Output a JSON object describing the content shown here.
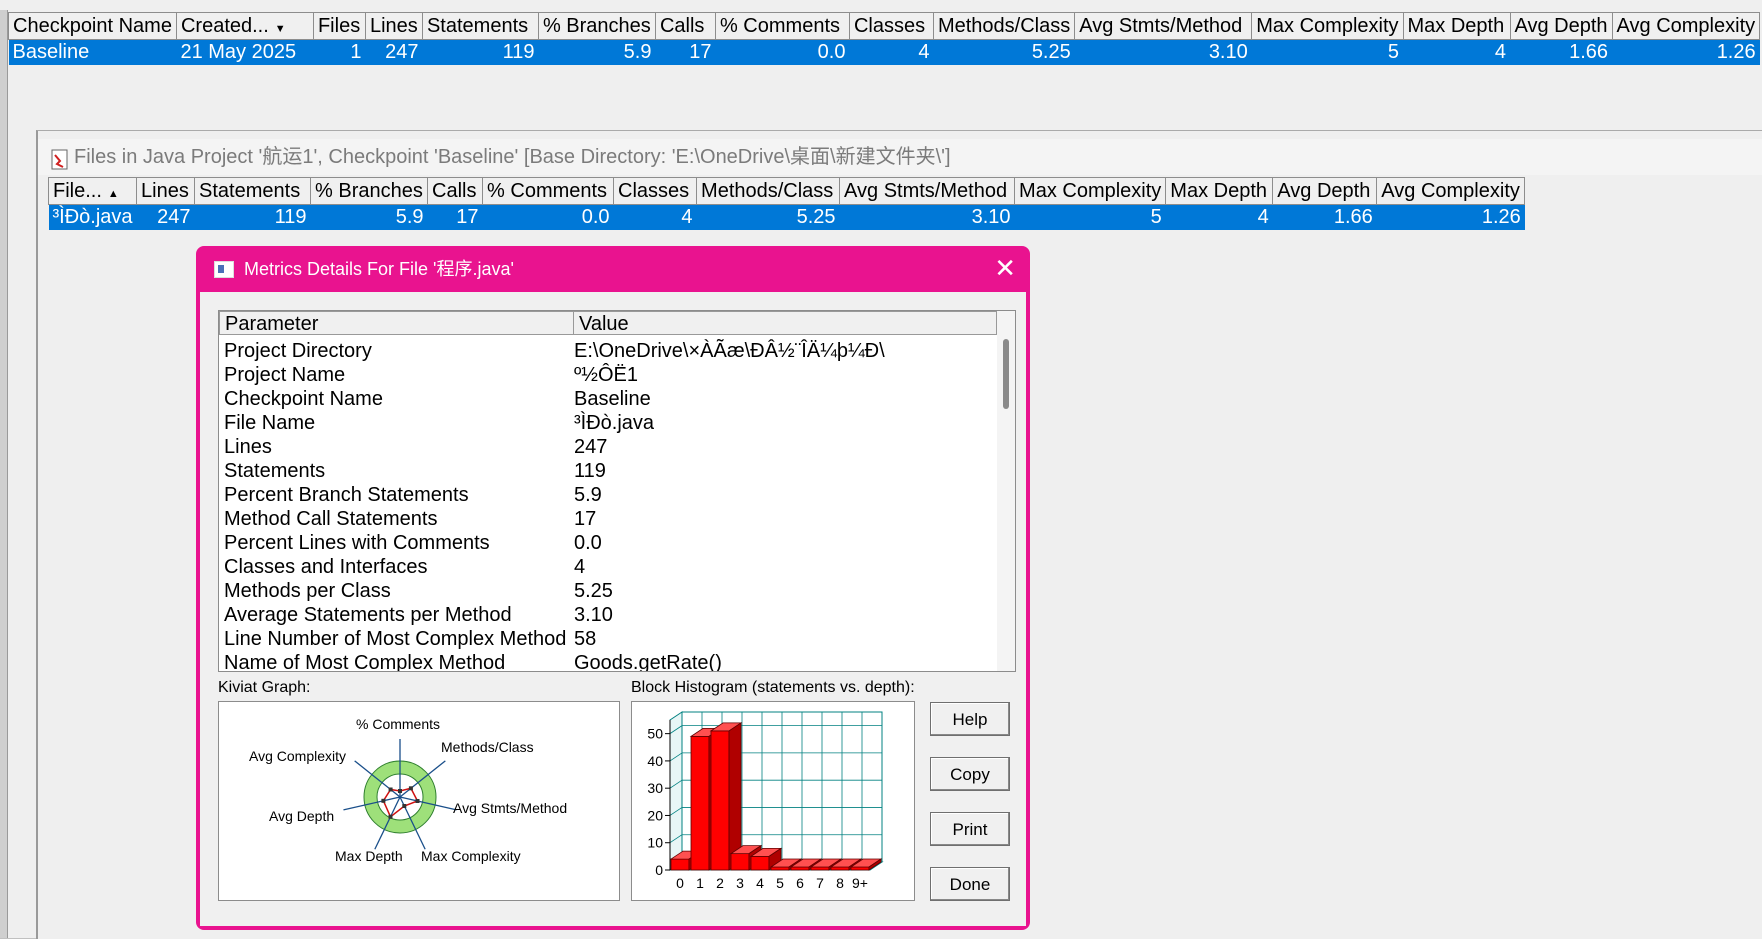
{
  "top_table": {
    "headers": [
      "Checkpoint Name",
      "Created...",
      "Files",
      "Lines",
      "Statements",
      "% Branches",
      "Calls",
      "% Comments",
      "Classes",
      "Methods/Class",
      "Avg Stmts/Method",
      "Max Complexity",
      "Max Depth",
      "Avg Depth",
      "Avg Complexity"
    ],
    "row": [
      "Baseline",
      "21 May 2025",
      "1",
      "247",
      "119",
      "5.9",
      "17",
      "0.0",
      "4",
      "5.25",
      "3.10",
      "5",
      "4",
      "1.66",
      "1.26"
    ]
  },
  "files_window": {
    "title": "Files in Java Project '航运1', Checkpoint 'Baseline'  [Base Directory: 'E:\\OneDrive\\桌面\\新建文件夹\\']",
    "headers": [
      "File...",
      "Lines",
      "Statements",
      "% Branches",
      "Calls",
      "% Comments",
      "Classes",
      "Methods/Class",
      "Avg Stmts/Method",
      "Max Complexity",
      "Max Depth",
      "Avg Depth",
      "Avg Complexity"
    ],
    "row": [
      "³ÌÐò.java",
      "247",
      "119",
      "5.9",
      "17",
      "0.0",
      "4",
      "5.25",
      "3.10",
      "5",
      "4",
      "1.66",
      "1.26"
    ]
  },
  "dialog": {
    "title": "Metrics Details For File '程序.java'",
    "close": "✕",
    "col_param": "Parameter",
    "col_value": "Value",
    "rows": [
      {
        "p": "Project Directory",
        "v": "E:\\OneDrive\\×ÀÃæ\\ÐÂ½¨ÎÄ¼þ¼Ð\\"
      },
      {
        "p": "Project Name",
        "v": "º½ÔË1"
      },
      {
        "p": "Checkpoint Name",
        "v": "Baseline"
      },
      {
        "p": "File Name",
        "v": "³ÌÐò.java"
      },
      {
        "p": "Lines",
        "v": "247"
      },
      {
        "p": "Statements",
        "v": "119"
      },
      {
        "p": "Percent Branch Statements",
        "v": "5.9"
      },
      {
        "p": "Method Call Statements",
        "v": "17"
      },
      {
        "p": "Percent Lines with Comments",
        "v": "0.0"
      },
      {
        "p": "Classes and Interfaces",
        "v": "4"
      },
      {
        "p": "Methods per Class",
        "v": "5.25"
      },
      {
        "p": "Average Statements per Method",
        "v": "3.10"
      },
      {
        "p": "Line Number of Most Complex Method",
        "v": "58"
      },
      {
        "p": "Name of Most Complex Method",
        "v": "Goods.getRate()"
      }
    ],
    "kiviat_label": "Kiviat Graph:",
    "kiviat_axes": [
      "% Comments",
      "Methods/Class",
      "Avg Stmts/Method",
      "Max Complexity",
      "Max Depth",
      "Avg Depth",
      "Avg Complexity"
    ],
    "histogram_label": "Block Histogram (statements vs. depth):",
    "buttons": {
      "help": "Help",
      "copy": "Copy",
      "print": "Print",
      "done": "Done"
    }
  },
  "chart_data": {
    "type": "bar",
    "title": "Block Histogram (statements vs. depth):",
    "categories": [
      "0",
      "1",
      "2",
      "3",
      "4",
      "5",
      "6",
      "7",
      "8",
      "9+"
    ],
    "values": [
      4,
      49,
      51,
      6,
      5,
      0,
      0,
      0,
      0,
      0
    ],
    "ylim": [
      0,
      55
    ],
    "yticks": [
      0,
      10,
      20,
      30,
      40,
      50
    ],
    "grid": true,
    "bar_color": "#ff0000",
    "grid_color": "#008080"
  }
}
